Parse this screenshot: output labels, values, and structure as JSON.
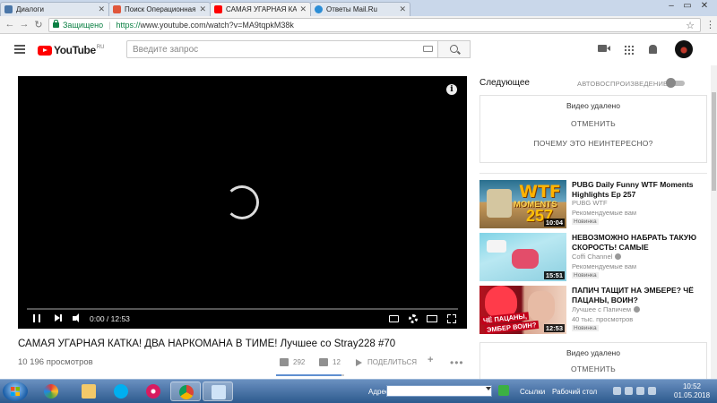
{
  "browser": {
    "tabs": [
      {
        "label": "Диалоги",
        "color": "#4a76a8"
      },
      {
        "label": "Поиск Операционная с",
        "color": "#e0563b"
      },
      {
        "label": "САМАЯ УГАРНАЯ КАТКА",
        "color": "#ff0000"
      },
      {
        "label": "Ответы Mail.Ru",
        "color": "#2b8dd6"
      }
    ],
    "secure_label": "Защищено",
    "url_proto": "https://",
    "url_rest": "www.youtube.com/watch?v=MA9tqpkM38k"
  },
  "youtube": {
    "logo_text": "YouTube",
    "logo_region": "RU",
    "search_placeholder": "Введите запрос"
  },
  "player": {
    "time": "0:00 / 12:53",
    "info_glyph": "i"
  },
  "video": {
    "title": "САМАЯ УГАРНАЯ КАТКА! ДВА НАРКОМАНА В ТИМЕ! Лучшее со Stray228 #70",
    "views": "10 196 просмотров",
    "likes": "292",
    "dislikes": "12",
    "share_label": "ПОДЕЛИТЬСЯ",
    "more_label": "•••",
    "like_ratio": 0.96
  },
  "sidebar": {
    "up_next": "Следующее",
    "autoplay": "АВТОВОСПРОИЗВЕДЕНИЕ",
    "removed_1": {
      "title": "Видео удалено",
      "undo": "ОТМЕНИТЬ",
      "why": "ПОЧЕМУ ЭТО НЕИНТЕРЕСНО?"
    },
    "removed_2": {
      "title": "Видео удалено",
      "undo": "ОТМЕНИТЬ"
    },
    "recs": [
      {
        "title": "PUBG Daily Funny WTF Moments Highlights Ep 257",
        "channel": "PUBG WTF",
        "meta": "Рекомендуемые вам",
        "badge": "Новинка",
        "duration": "10:04",
        "thumb_text_1": "WTF",
        "thumb_text_2": "MOMENTS",
        "thumb_text_3": "257"
      },
      {
        "title": "НЕВОЗМОЖНО НАБРАТЬ ТАКУЮ СКОРОСТЬ! САМЫЕ",
        "channel": "Coffi Channel",
        "meta": "Рекомендуемые вам",
        "badge": "Новинка",
        "duration": "15:51"
      },
      {
        "title": "ПАПИЧ ТАЩИТ НА ЭМБЕРЕ? ЧЁ ПАЦАНЫ, ВОИН?",
        "channel": "Лучшее с Папичем",
        "meta": "40 тыс. просмотров",
        "badge": "Новинка",
        "duration": "12:53",
        "thumb_text_1": "ЧЁ ПАЦАНЫ,",
        "thumb_text_2": "ЭМБЕР ВОИН?"
      }
    ]
  },
  "taskbar": {
    "address_label": "Адрес",
    "links_label": "Ссылки",
    "desktop_label": "Рабочий стол",
    "time": "10:52",
    "date": "01.05.2018"
  }
}
